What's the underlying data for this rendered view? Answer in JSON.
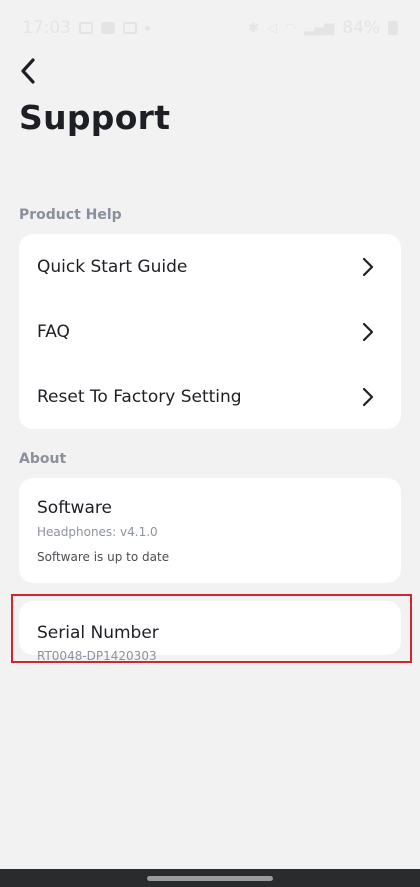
{
  "status_bar": {
    "time": "17:03",
    "battery": "84%"
  },
  "header": {
    "title": "Support"
  },
  "product_help": {
    "label": "Product Help",
    "items": [
      {
        "label": "Quick Start Guide"
      },
      {
        "label": "FAQ"
      },
      {
        "label": "Reset To Factory Setting"
      }
    ]
  },
  "about": {
    "label": "About",
    "software": {
      "title": "Software",
      "version": "Headphones: v4.1.0",
      "status": "Software is up to date"
    },
    "serial": {
      "title": "Serial Number",
      "value": "RT0048-DP1420303"
    }
  },
  "colors": {
    "background": "#f2f2f3",
    "card": "#ffffff",
    "section_label": "#8a909b",
    "highlight": "#d32531"
  }
}
